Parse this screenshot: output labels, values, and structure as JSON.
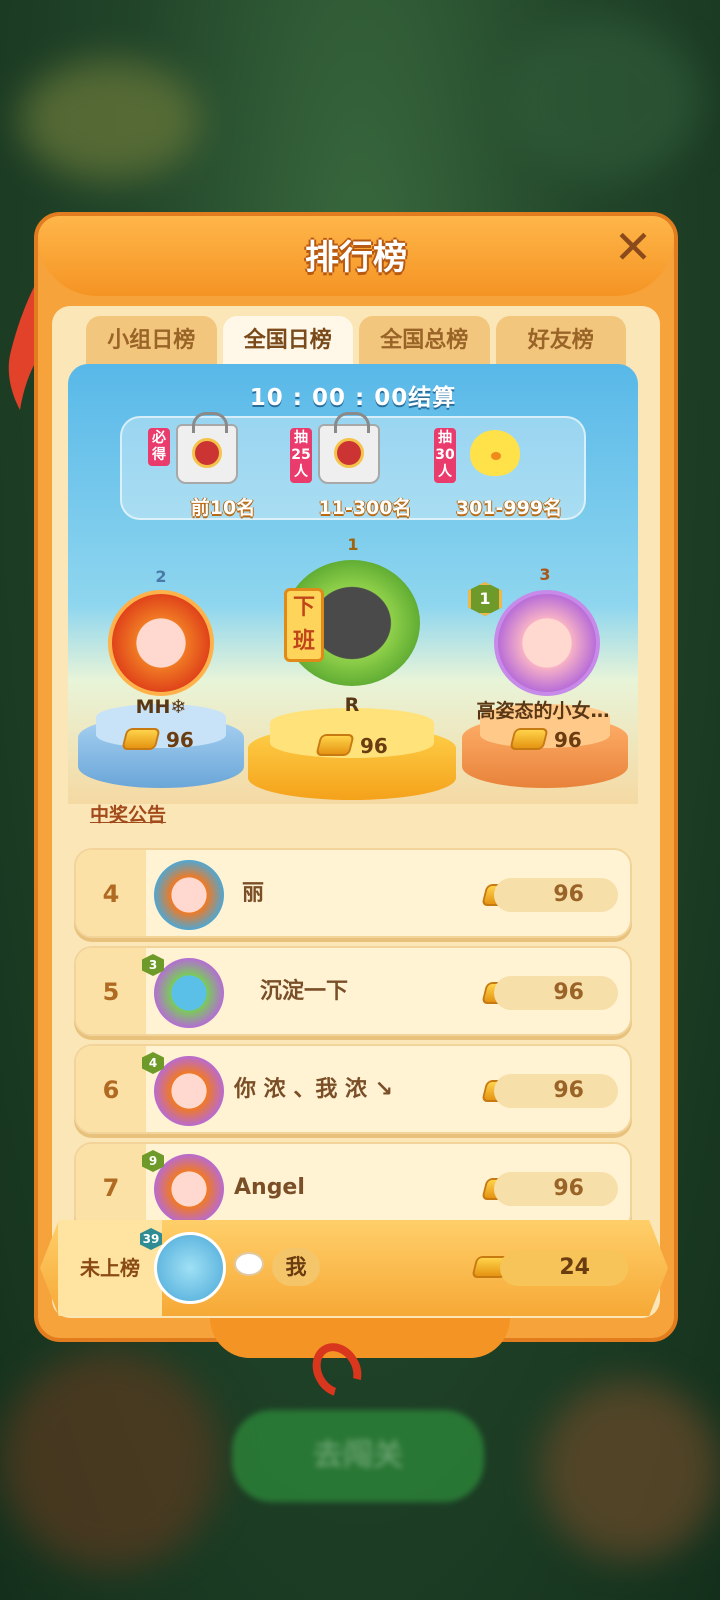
{
  "header": {
    "title": "排行榜",
    "close_icon": "close-icon"
  },
  "tabs": [
    {
      "label": "小组日榜",
      "active": false
    },
    {
      "label": "全国日榜",
      "active": true
    },
    {
      "label": "全国总榜",
      "active": false
    },
    {
      "label": "好友榜",
      "active": false
    }
  ],
  "settlement": {
    "timer_text": "10 : 00 : 00结算"
  },
  "prizes": [
    {
      "tag": "必得",
      "label": "前10名",
      "icon": "gift-bag-icon"
    },
    {
      "tag": "抽25人",
      "label": "11-300名",
      "icon": "gift-bag-icon"
    },
    {
      "tag": "抽30人",
      "label": "301-999名",
      "icon": "chick-icon"
    }
  ],
  "podium": [
    {
      "rank": "2",
      "name": "MH❄",
      "score": "96",
      "color": "#7fb5e0"
    },
    {
      "rank": "1",
      "name": "R",
      "score": "96",
      "badge": "下班",
      "color": "#ffc53a"
    },
    {
      "rank": "3",
      "name": "高姿态的小女…",
      "score": "96",
      "level": "1",
      "color": "#f4a25a"
    }
  ],
  "notice_link": "中奖公告",
  "rows": [
    {
      "rank": "4",
      "name": "丽",
      "score": "96"
    },
    {
      "rank": "5",
      "name": "沉淀一下",
      "score": "96",
      "level": "3"
    },
    {
      "rank": "6",
      "name": "你 浓 、我 浓 ↘",
      "score": "96",
      "level": "4"
    },
    {
      "rank": "7",
      "name": "Angel",
      "score": "96",
      "level": "9"
    }
  ],
  "me": {
    "status": "未上榜",
    "level": "39",
    "name": "我",
    "score": "24"
  },
  "background": {
    "button_label": "去闯关"
  }
}
